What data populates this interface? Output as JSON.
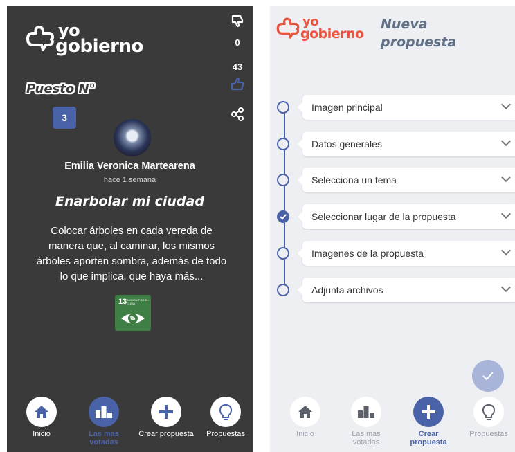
{
  "left_screen": {
    "logo": {
      "line1": "yo",
      "line2": "gobierno"
    },
    "dislike_count": "0",
    "like_count": "43",
    "puesto_label": "Puesto N°",
    "rank": "3",
    "author": "Emilia Veronica Martearena",
    "time_ago": "hace 1 semana",
    "proposal_title": "Enarbolar mi ciudad",
    "proposal_description": "Colocar árboles en cada vereda de manera que, al caminar, los mismos árboles aporten sombra, además de todo lo que implica, que haya más...",
    "sdg_badge": {
      "number": "13",
      "text": "ACCIÓN POR EL CLIMA"
    },
    "nav": [
      {
        "label": "Inicio",
        "icon": "home-icon"
      },
      {
        "label": "Las mas votadas",
        "icon": "podium-icon",
        "active": true
      },
      {
        "label": "Crear propuesta",
        "icon": "plus-icon"
      },
      {
        "label": "Propuestas",
        "icon": "lightbulb-icon"
      }
    ]
  },
  "right_screen": {
    "logo": {
      "line1": "yo",
      "line2": "gobierno"
    },
    "title_line1": "Nueva",
    "title_line2": "propuesta",
    "steps": [
      {
        "label": "Imagen principal",
        "done": false
      },
      {
        "label": "Datos generales",
        "done": false
      },
      {
        "label": "Selecciona un tema",
        "done": false
      },
      {
        "label": "Seleccionar lugar de la propuesta",
        "done": true
      },
      {
        "label": "Imagenes de la propuesta",
        "done": false
      },
      {
        "label": "Adjunta archivos",
        "done": false
      }
    ],
    "nav": [
      {
        "label": "Inicio",
        "icon": "home-icon"
      },
      {
        "label": "Las mas votadas",
        "icon": "podium-icon"
      },
      {
        "label": "Crear propuesta",
        "icon": "plus-icon",
        "active": true
      },
      {
        "label": "Propuestas",
        "icon": "lightbulb-icon"
      }
    ]
  },
  "colors": {
    "accent": "#4a63a8",
    "brand_orange": "#e9553e",
    "dark_bg": "#3a3a3a",
    "light_bg": "#eeeff3"
  }
}
